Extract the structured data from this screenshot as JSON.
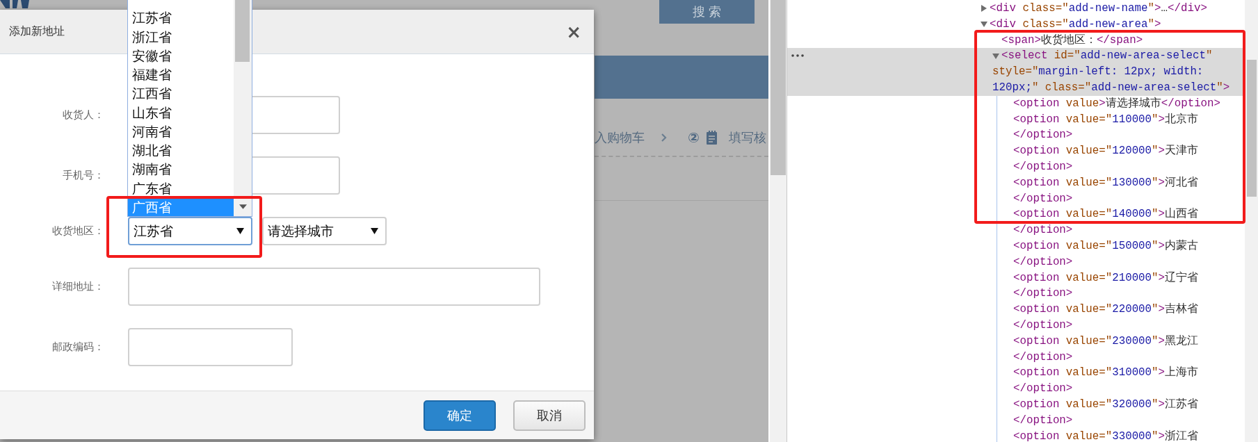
{
  "background_page": {
    "search_button": "搜 索",
    "steps": {
      "previous": "入购物车",
      "number": "②",
      "current": "填写核"
    }
  },
  "dialog": {
    "title": "添加新地址",
    "close": "×",
    "fields": [
      {
        "kind": "input",
        "label": "收货人："
      },
      {
        "kind": "input",
        "label": "手机号："
      },
      {
        "kind": "region",
        "label": "收货地区：",
        "selects": [
          {
            "value": "江苏省",
            "focused": true,
            "dropdown": {
              "options": [
                {
                  "label": "江苏省",
                  "selected": false
                },
                {
                  "label": "浙江省",
                  "selected": false
                },
                {
                  "label": "安徽省",
                  "selected": false
                },
                {
                  "label": "福建省",
                  "selected": false
                },
                {
                  "label": "江西省",
                  "selected": false
                },
                {
                  "label": "山东省",
                  "selected": false
                },
                {
                  "label": "河南省",
                  "selected": false
                },
                {
                  "label": "湖北省",
                  "selected": false
                },
                {
                  "label": "湖南省",
                  "selected": false
                },
                {
                  "label": "广东省",
                  "selected": false
                },
                {
                  "label": "广西省",
                  "selected": true
                }
              ]
            }
          },
          {
            "value": "请选择城市",
            "focused": false
          }
        ]
      },
      {
        "kind": "address",
        "label": "详细地址："
      },
      {
        "kind": "code",
        "label": "邮政编码："
      }
    ],
    "buttons": [
      {
        "label": "确定",
        "kind": "primary"
      },
      {
        "label": "取消",
        "kind": "default"
      }
    ]
  },
  "devtools": {
    "nodes": [
      {
        "kind": "container",
        "expanded": false,
        "selected": false,
        "lines": [
          [
            {
              "kind": "tag",
              "text": "<div"
            },
            {
              "kind": "attr",
              "text": " class=\""
            },
            {
              "kind": "value",
              "text": "add-new-name"
            },
            {
              "kind": "attr",
              "text": "\""
            },
            {
              "kind": "tag",
              "text": ">"
            },
            {
              "kind": "text",
              "text": "…"
            },
            {
              "kind": "tag",
              "text": "</div>"
            }
          ]
        ]
      },
      {
        "kind": "container",
        "expanded": true,
        "selected": false,
        "lines": [
          [
            {
              "kind": "tag",
              "text": "<div"
            },
            {
              "kind": "attr",
              "text": " class=\""
            },
            {
              "kind": "value",
              "text": "add-new-area"
            },
            {
              "kind": "attr",
              "text": "\""
            },
            {
              "kind": "tag",
              "text": ">"
            }
          ]
        ],
        "children": [
          {
            "kind": "leaf",
            "selected": false,
            "lines": [
              [
                {
                  "kind": "tag",
                  "text": "<span>"
                },
                {
                  "kind": "text",
                  "text": "收货地区："
                },
                {
                  "kind": "tag",
                  "text": "</span>"
                }
              ]
            ]
          },
          {
            "kind": "container",
            "expanded": true,
            "selected": true,
            "lines": [
              [
                {
                  "kind": "tag",
                  "text": "<select"
                },
                {
                  "kind": "attr",
                  "text": " id=\""
                },
                {
                  "kind": "value",
                  "text": "add-new-area-select"
                },
                {
                  "kind": "attr",
                  "text": "\""
                }
              ],
              [
                {
                  "kind": "attr",
                  "text": "style=\""
                },
                {
                  "kind": "value",
                  "text": "margin-left: 12px; width:"
                }
              ],
              [
                {
                  "kind": "value",
                  "text": "120px;"
                },
                {
                  "kind": "attr",
                  "text": "\" class=\""
                },
                {
                  "kind": "value",
                  "text": "add-new-area-select"
                },
                {
                  "kind": "attr",
                  "text": "\""
                },
                {
                  "kind": "tag",
                  "text": ">"
                }
              ]
            ],
            "children": [
              {
                "kind": "leaf",
                "selected": false,
                "lines": [
                  [
                    {
                      "kind": "tag",
                      "text": "<option"
                    },
                    {
                      "kind": "attr",
                      "text": " value"
                    },
                    {
                      "kind": "tag",
                      "text": ">"
                    },
                    {
                      "kind": "text",
                      "text": "请选择城市"
                    },
                    {
                      "kind": "tag",
                      "text": "</option>"
                    }
                  ]
                ]
              },
              {
                "kind": "leaf",
                "selected": false,
                "lines": [
                  [
                    {
                      "kind": "tag",
                      "text": "<option"
                    },
                    {
                      "kind": "attr",
                      "text": " value=\""
                    },
                    {
                      "kind": "value",
                      "text": "110000"
                    },
                    {
                      "kind": "attr",
                      "text": "\""
                    },
                    {
                      "kind": "tag",
                      "text": ">"
                    },
                    {
                      "kind": "text",
                      "text": "北京市"
                    }
                  ],
                  [
                    {
                      "kind": "tag",
                      "text": "</option>"
                    }
                  ]
                ]
              },
              {
                "kind": "leaf",
                "selected": false,
                "lines": [
                  [
                    {
                      "kind": "tag",
                      "text": "<option"
                    },
                    {
                      "kind": "attr",
                      "text": " value=\""
                    },
                    {
                      "kind": "value",
                      "text": "120000"
                    },
                    {
                      "kind": "attr",
                      "text": "\""
                    },
                    {
                      "kind": "tag",
                      "text": ">"
                    },
                    {
                      "kind": "text",
                      "text": "天津市"
                    }
                  ],
                  [
                    {
                      "kind": "tag",
                      "text": "</option>"
                    }
                  ]
                ]
              },
              {
                "kind": "leaf",
                "selected": false,
                "lines": [
                  [
                    {
                      "kind": "tag",
                      "text": "<option"
                    },
                    {
                      "kind": "attr",
                      "text": " value=\""
                    },
                    {
                      "kind": "value",
                      "text": "130000"
                    },
                    {
                      "kind": "attr",
                      "text": "\""
                    },
                    {
                      "kind": "tag",
                      "text": ">"
                    },
                    {
                      "kind": "text",
                      "text": "河北省"
                    }
                  ],
                  [
                    {
                      "kind": "tag",
                      "text": "</option>"
                    }
                  ]
                ]
              },
              {
                "kind": "leaf",
                "selected": false,
                "lines": [
                  [
                    {
                      "kind": "tag",
                      "text": "<option"
                    },
                    {
                      "kind": "attr",
                      "text": " value=\""
                    },
                    {
                      "kind": "value",
                      "text": "140000"
                    },
                    {
                      "kind": "attr",
                      "text": "\""
                    },
                    {
                      "kind": "tag",
                      "text": ">"
                    },
                    {
                      "kind": "text",
                      "text": "山西省"
                    }
                  ],
                  [
                    {
                      "kind": "tag",
                      "text": "</option>"
                    }
                  ]
                ]
              },
              {
                "kind": "leaf",
                "selected": false,
                "lines": [
                  [
                    {
                      "kind": "tag",
                      "text": "<option"
                    },
                    {
                      "kind": "attr",
                      "text": " value=\""
                    },
                    {
                      "kind": "value",
                      "text": "150000"
                    },
                    {
                      "kind": "attr",
                      "text": "\""
                    },
                    {
                      "kind": "tag",
                      "text": ">"
                    },
                    {
                      "kind": "text",
                      "text": "内蒙古"
                    }
                  ],
                  [
                    {
                      "kind": "tag",
                      "text": "</option>"
                    }
                  ]
                ]
              },
              {
                "kind": "leaf",
                "selected": false,
                "lines": [
                  [
                    {
                      "kind": "tag",
                      "text": "<option"
                    },
                    {
                      "kind": "attr",
                      "text": " value=\""
                    },
                    {
                      "kind": "value",
                      "text": "210000"
                    },
                    {
                      "kind": "attr",
                      "text": "\""
                    },
                    {
                      "kind": "tag",
                      "text": ">"
                    },
                    {
                      "kind": "text",
                      "text": "辽宁省"
                    }
                  ],
                  [
                    {
                      "kind": "tag",
                      "text": "</option>"
                    }
                  ]
                ]
              },
              {
                "kind": "leaf",
                "selected": false,
                "lines": [
                  [
                    {
                      "kind": "tag",
                      "text": "<option"
                    },
                    {
                      "kind": "attr",
                      "text": " value=\""
                    },
                    {
                      "kind": "value",
                      "text": "220000"
                    },
                    {
                      "kind": "attr",
                      "text": "\""
                    },
                    {
                      "kind": "tag",
                      "text": ">"
                    },
                    {
                      "kind": "text",
                      "text": "吉林省"
                    }
                  ],
                  [
                    {
                      "kind": "tag",
                      "text": "</option>"
                    }
                  ]
                ]
              },
              {
                "kind": "leaf",
                "selected": false,
                "lines": [
                  [
                    {
                      "kind": "tag",
                      "text": "<option"
                    },
                    {
                      "kind": "attr",
                      "text": " value=\""
                    },
                    {
                      "kind": "value",
                      "text": "230000"
                    },
                    {
                      "kind": "attr",
                      "text": "\""
                    },
                    {
                      "kind": "tag",
                      "text": ">"
                    },
                    {
                      "kind": "text",
                      "text": "黑龙江"
                    }
                  ],
                  [
                    {
                      "kind": "tag",
                      "text": "</option>"
                    }
                  ]
                ]
              },
              {
                "kind": "leaf",
                "selected": false,
                "lines": [
                  [
                    {
                      "kind": "tag",
                      "text": "<option"
                    },
                    {
                      "kind": "attr",
                      "text": " value=\""
                    },
                    {
                      "kind": "value",
                      "text": "310000"
                    },
                    {
                      "kind": "attr",
                      "text": "\""
                    },
                    {
                      "kind": "tag",
                      "text": ">"
                    },
                    {
                      "kind": "text",
                      "text": "上海市"
                    }
                  ],
                  [
                    {
                      "kind": "tag",
                      "text": "</option>"
                    }
                  ]
                ]
              },
              {
                "kind": "leaf",
                "selected": false,
                "lines": [
                  [
                    {
                      "kind": "tag",
                      "text": "<option"
                    },
                    {
                      "kind": "attr",
                      "text": " value=\""
                    },
                    {
                      "kind": "value",
                      "text": "320000"
                    },
                    {
                      "kind": "attr",
                      "text": "\""
                    },
                    {
                      "kind": "tag",
                      "text": ">"
                    },
                    {
                      "kind": "text",
                      "text": "江苏省"
                    }
                  ],
                  [
                    {
                      "kind": "tag",
                      "text": "</option>"
                    }
                  ]
                ]
              },
              {
                "kind": "leaf",
                "selected": false,
                "lines": [
                  [
                    {
                      "kind": "tag",
                      "text": "<option"
                    },
                    {
                      "kind": "attr",
                      "text": " value=\""
                    },
                    {
                      "kind": "value",
                      "text": "330000"
                    },
                    {
                      "kind": "attr",
                      "text": "\""
                    },
                    {
                      "kind": "tag",
                      "text": ">"
                    },
                    {
                      "kind": "text",
                      "text": "浙江省"
                    }
                  ]
                ]
              }
            ]
          }
        ]
      }
    ]
  }
}
